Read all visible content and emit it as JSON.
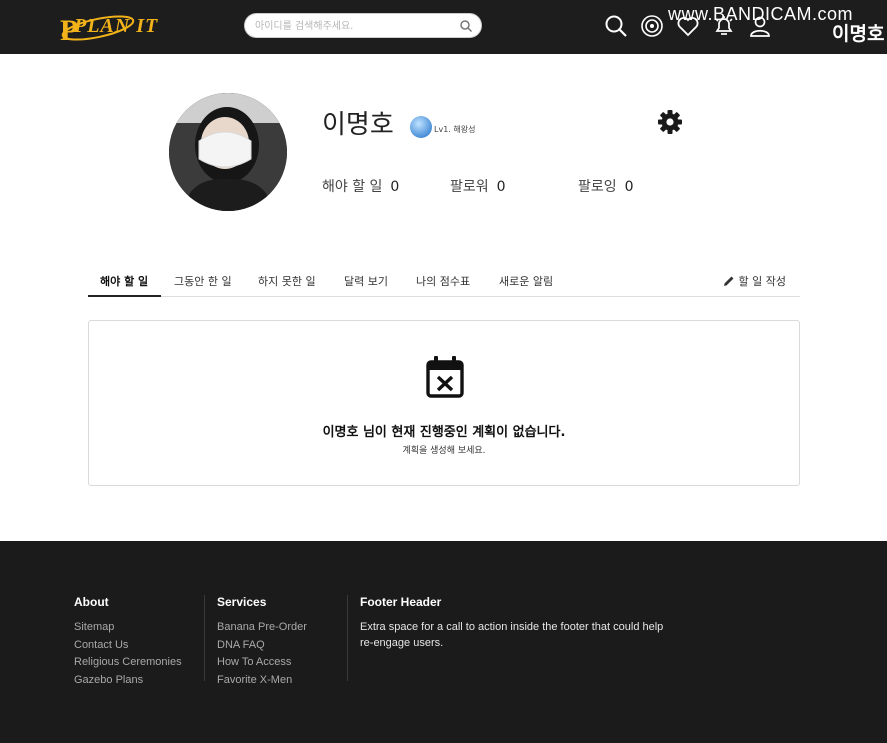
{
  "header": {
    "logo_text": "PLAN IT",
    "search": {
      "placeholder": "아이디를 검색해주세요.",
      "value": ""
    },
    "icons": [
      "search-icon",
      "radar-icon",
      "heart-icon",
      "bell-icon",
      "user-icon"
    ],
    "watermark": "www.BANDICAM.com",
    "user_name": "이명호"
  },
  "profile": {
    "name": "이명호",
    "level": "Lv1. 해왕성",
    "stats": [
      {
        "label": "해야 할 일",
        "value": "0"
      },
      {
        "label": "팔로워",
        "value": "0"
      },
      {
        "label": "팔로잉",
        "value": "0"
      }
    ]
  },
  "tabs": {
    "items": [
      {
        "label": "해야 할 일"
      },
      {
        "label": "그동안 한 일"
      },
      {
        "label": "하지 못한 일"
      },
      {
        "label": "달력 보기"
      },
      {
        "label": "나의 점수표"
      },
      {
        "label": "새로운 알림"
      }
    ],
    "active_index": 0,
    "write_label": "할 일 작성"
  },
  "empty_state": {
    "title": "이명호 님이 현재 진행중인 계획이 없습니다.",
    "subtitle": "계획을 생성해 보세요."
  },
  "footer": {
    "columns": [
      {
        "header": "About",
        "links": [
          "Sitemap",
          "Contact Us",
          "Religious Ceremonies",
          "Gazebo Plans"
        ]
      },
      {
        "header": "Services",
        "links": [
          "Banana Pre-Order",
          "DNA FAQ",
          "How To Access",
          "Favorite X-Men"
        ]
      }
    ],
    "cta": {
      "header": "Footer Header",
      "text": "Extra space for a call to action inside the footer that could help re-engage users."
    }
  },
  "colors": {
    "topbar": "#1d1d1d",
    "footer": "#1b1b1b",
    "logo": "#f2b21a",
    "badge": "#4a8fd8"
  }
}
